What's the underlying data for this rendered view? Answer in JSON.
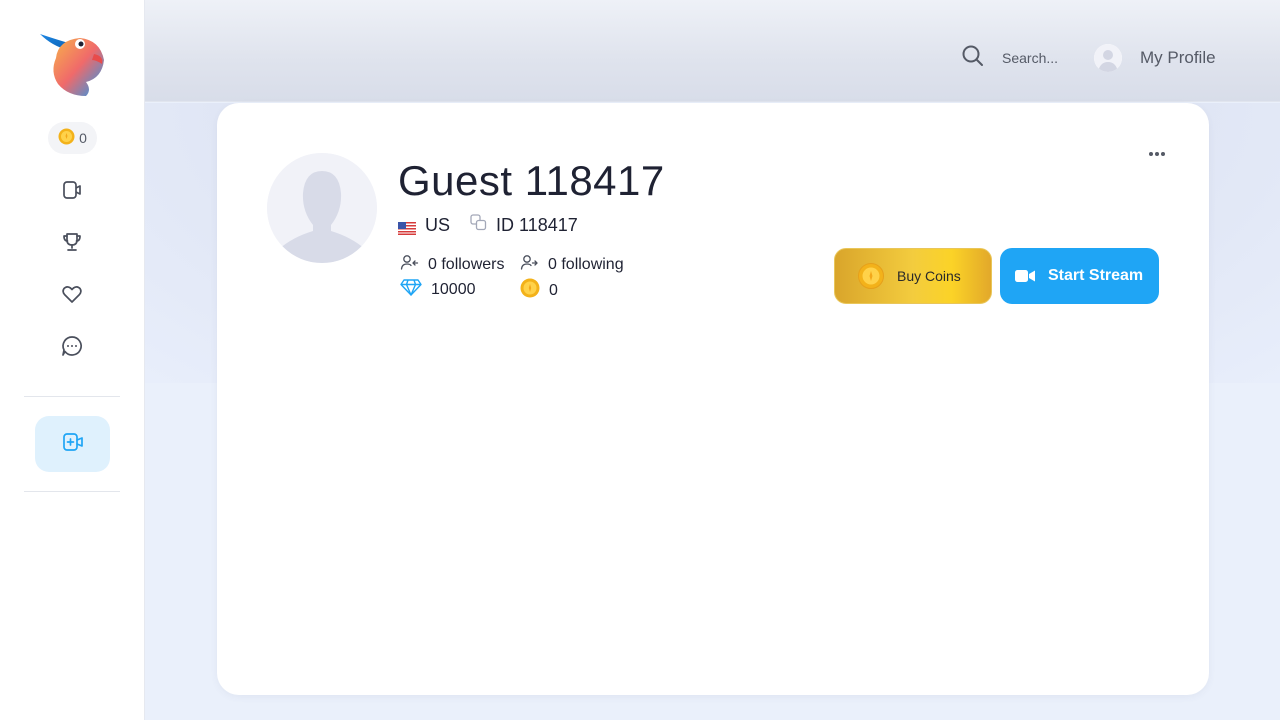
{
  "sidebar": {
    "coin_balance": "0",
    "icons": [
      "video-icon",
      "trophy-icon",
      "heart-icon",
      "chat-icon",
      "add-stream-icon"
    ]
  },
  "header": {
    "search_placeholder": "Search...",
    "profile_label": "My Profile"
  },
  "profile": {
    "name": "Guest 118417",
    "country": "US",
    "id_label": "ID 118417",
    "followers": "0 followers",
    "following": "0 following",
    "diamonds": "10000",
    "coins": "0"
  },
  "actions": {
    "buy_coins": "Buy Coins",
    "start_stream": "Start Stream"
  },
  "colors": {
    "accent": "#1fa5f5",
    "coin_gold": "#f3cc3e",
    "text_dark": "#1f2233"
  }
}
